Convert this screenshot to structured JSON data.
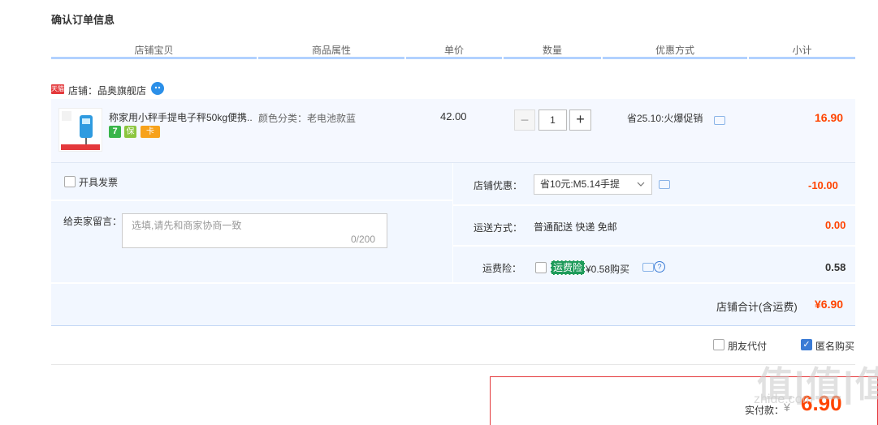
{
  "title": "确认订单信息",
  "columns": [
    "店铺宝贝",
    "商品属性",
    "单价",
    "数量",
    "优惠方式",
    "小计"
  ],
  "shop": {
    "badge": "天猫",
    "name": "店铺：品奥旗舰店"
  },
  "item": {
    "name": "称家用小秤手提电子秤50kg便携..",
    "attribute": "颜色分类：老电池款蓝",
    "price": "42.00",
    "quantity": "1",
    "minus": "−",
    "plus": "+",
    "promo": "省25.10:火爆促销",
    "subtotal": "16.90",
    "service_icons": [
      "7",
      "保",
      "卡"
    ]
  },
  "invoice": {
    "label": "开具发票"
  },
  "memo": {
    "label": "给卖家留言：",
    "placeholder": "选填,请先和商家协商一致",
    "count": "0/200"
  },
  "shop_discount": {
    "label": "店铺优惠：",
    "selected": "省10元:M5.14手提",
    "value": "-10.00"
  },
  "shipping": {
    "label": "运送方式：",
    "method": "普通配送 快递 免邮",
    "value": "0.00"
  },
  "insurance": {
    "label": "运费险：",
    "badge": "运费险",
    "price": "¥0.58购买",
    "value": "0.58"
  },
  "store_total": {
    "label": "店铺合计(含运费)",
    "value": "¥6.90"
  },
  "options": {
    "friend_pay": "朋友代付",
    "anonymous": "匿名购买"
  },
  "payable": {
    "label": "实付款：",
    "currency": "¥",
    "value": "6.90"
  },
  "watermark": {
    "text": "值|值|值",
    "sub": "zhide.com"
  }
}
